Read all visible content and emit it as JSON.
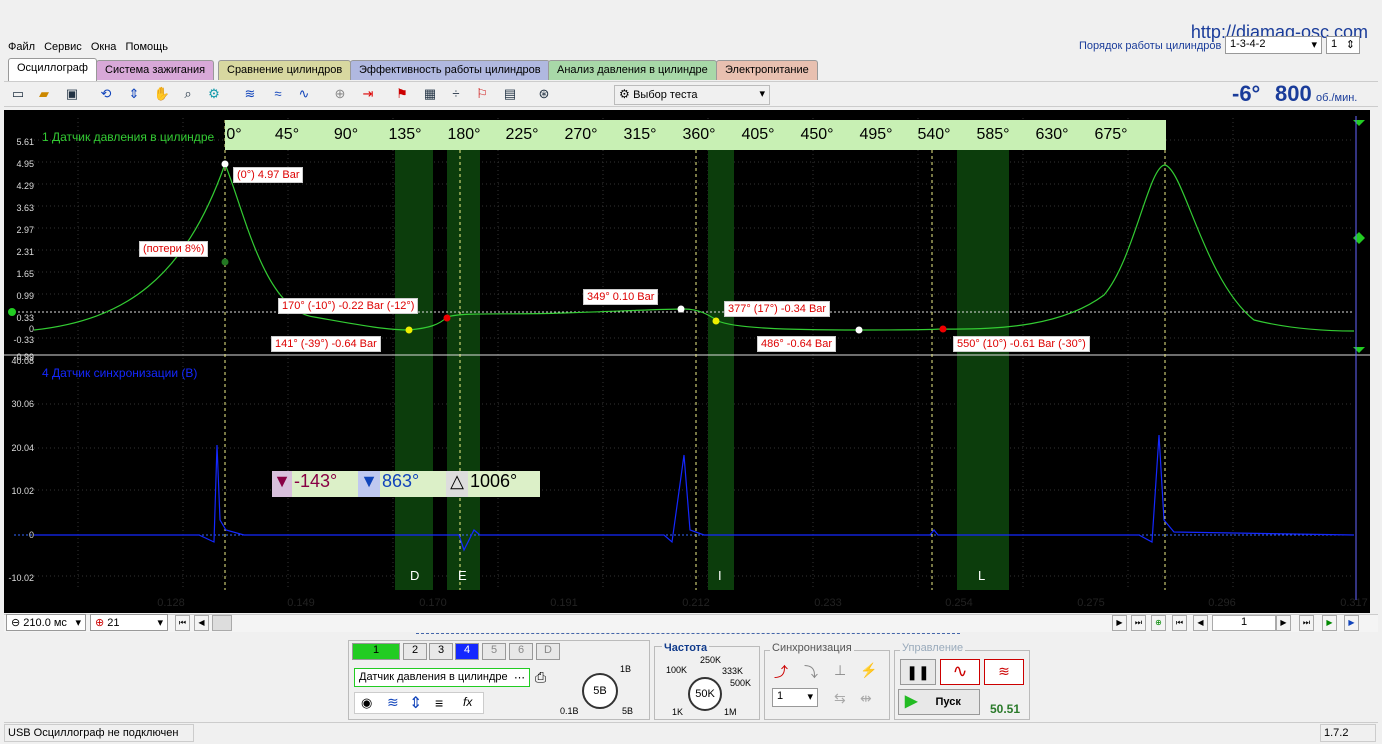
{
  "menu": [
    "Файл",
    "Сервис",
    "Окна",
    "Помощь"
  ],
  "website": "http://diamag-osc.com",
  "firing_order": {
    "label": "Порядок работы цилиндров",
    "value": "1-3-4-2",
    "cyl": "1"
  },
  "tabs": [
    {
      "label": "Осциллограф",
      "color": "#ffffff"
    },
    {
      "label": "Система зажигания",
      "color": "#d8a8d8"
    },
    {
      "label": "Сравнение цилиндров",
      "color": "#d8d8a0"
    },
    {
      "label": "Эффективность работы цилиндров",
      "color": "#b0b8e0"
    },
    {
      "label": "Анализ давления в цилиндре",
      "color": "#a8d8a8"
    },
    {
      "label": "Электропитание",
      "color": "#e8c0b0"
    }
  ],
  "toolbar": {
    "test_select": "Выбор теста",
    "angle": "-6°",
    "rpm": "800",
    "rpm_unit": "об./мин."
  },
  "plot": {
    "ch1_label": "1 Датчик давления в цилиндре",
    "ch4_label": "4 Датчик синхронизации (В)",
    "ch1_ticks": [
      "5.61",
      "4.95",
      "4.29",
      "3.63",
      "2.97",
      "2.31",
      "1.65",
      "0.99",
      "0.33",
      "0",
      "-0.33",
      "-0.99"
    ],
    "ch4_ticks": [
      "40.08",
      "30.06",
      "20.04",
      "10.02",
      "0",
      "-10.02"
    ],
    "deg_ticks": [
      "0°",
      "45°",
      "90°",
      "135°",
      "180°",
      "225°",
      "270°",
      "315°",
      "360°",
      "405°",
      "450°",
      "495°",
      "540°",
      "585°",
      "630°",
      "675°"
    ],
    "x_ticks": [
      "0.128",
      "0.149",
      "0.170",
      "0.191",
      "0.212",
      "0.233",
      "0.254",
      "0.275",
      "0.296",
      "0.317"
    ],
    "zones": [
      "D",
      "E",
      "I",
      "L"
    ],
    "annotations": {
      "a0": "(0°) 4.97 Bar",
      "a1": "(потери 8%)",
      "a2": "170° (-10°) -0.22 Bar (-12°)",
      "a3": "141° (-39°) -0.64 Bar",
      "a4": "349° 0.10 Bar",
      "a5": "377° (17°) -0.34 Bar",
      "a6": "486° -0.64 Bar",
      "a7": "550° (10°) -0.61 Bar (-30°)"
    },
    "markers": {
      "m1": "-143°",
      "m2": "863°",
      "delta": "1006°"
    }
  },
  "scroll": {
    "time": "210.0 мс",
    "zoom": "21",
    "page": "1"
  },
  "channels": {
    "buttons": [
      "1",
      "2",
      "3",
      "4",
      "5",
      "6",
      "D"
    ],
    "sensor": "Датчик давления в цилиндре",
    "knob": "5В",
    "knob_min": "0.1В",
    "knob_max": "5В",
    "knob_top": "1В"
  },
  "freq": {
    "title": "Частота",
    "value": "50K",
    "l100": "100K",
    "l250": "250K",
    "l333": "333K",
    "l500": "500K",
    "l1k": "1K",
    "l1m": "1M"
  },
  "sync": {
    "title": "Синхронизация",
    "ch": "1"
  },
  "control": {
    "title": "Управление",
    "start": "Пуск",
    "fps": "50.51"
  },
  "status": {
    "text": "USB Осциллограф не подключен",
    "version": "1.7.2"
  }
}
